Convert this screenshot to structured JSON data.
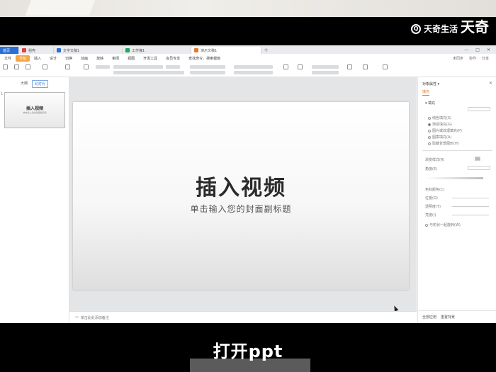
{
  "watermark": {
    "brand": "天奇生活",
    "corner_text": "天奇"
  },
  "caption": "打开ppt",
  "tabs": [
    {
      "label": "首页",
      "icon": "home-icon"
    },
    {
      "label": "稻壳",
      "icon": "docer-icon",
      "color": "#e0443b"
    },
    {
      "label": "文字文稿1",
      "icon": "doc-icon",
      "color": "#2b6fd6"
    },
    {
      "label": "工作簿1",
      "icon": "sheet-icon",
      "color": "#21a366"
    },
    {
      "label": "演示文稿1",
      "icon": "ppt-icon",
      "color": "#e07a2e"
    }
  ],
  "menu": [
    "文件",
    "开始",
    "插入",
    "设计",
    "切换",
    "动画",
    "放映",
    "审阅",
    "视图",
    "开发工具",
    "会员专享"
  ],
  "menu_active": "开始",
  "menu_right": [
    "查找命令、搜索模板",
    "未同步",
    "协作",
    "分享"
  ],
  "left_panel": {
    "tabs": [
      "大纲",
      "幻灯片"
    ],
    "active_tab": "幻灯片",
    "add": "+"
  },
  "slide": {
    "number": "1",
    "title": "插入视频",
    "subtitle": "单击输入您的封面副标题"
  },
  "notes_placeholder": "单击此处添加备注",
  "right_panel": {
    "title": "对象属性 ▾",
    "tab": "填充",
    "section_fill": "▾ 填充",
    "fill_options": [
      "纯色填充(S)",
      "渐变填充(G)",
      "图片或纹理填充(P)",
      "图案填充(A)",
      "隐藏背景图形(H)"
    ],
    "fill_selected": 1,
    "gradient_style": "渐变样式(R)",
    "angle": "角度(E)",
    "color_stops": "色标颜色(C)",
    "position": "位置(O)",
    "transparency": "透明度(T)",
    "brightness": "亮度(I)",
    "rotate_with_shape": "与形状一起旋转(W)",
    "bottom_buttons": [
      "全部应用",
      "重置背景"
    ]
  },
  "colors": {
    "home_tab": "#2b6fd6",
    "active_menu": "#f3a54a",
    "accent": "#e07a2e"
  }
}
